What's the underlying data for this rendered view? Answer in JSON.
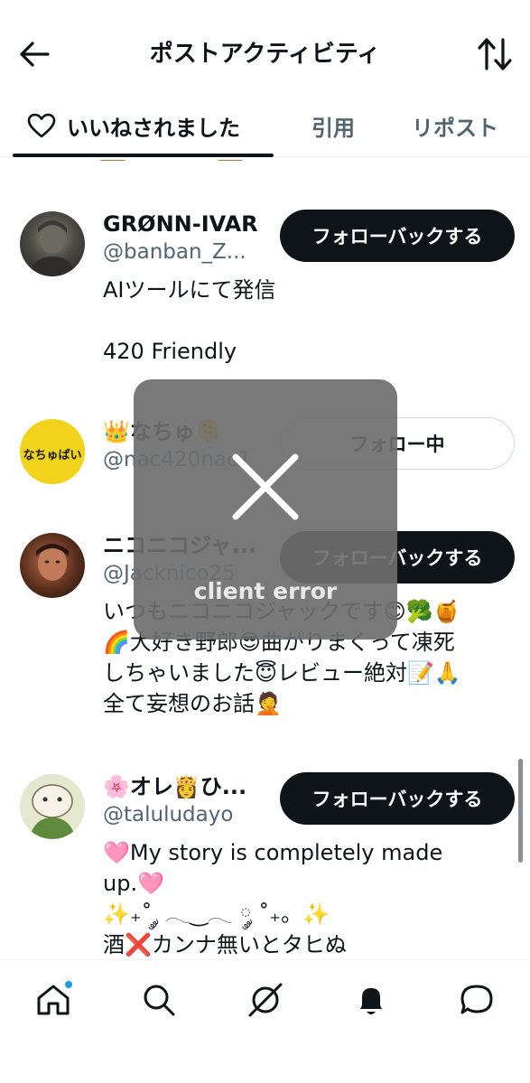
{
  "header": {
    "title": "ポストアクティビティ",
    "back_icon": "arrow-left-icon",
    "sort_icon": "sort-arrows-icon"
  },
  "tabs": [
    {
      "label": "いいねされました",
      "icon": "heart-icon",
      "active": true
    },
    {
      "label": "引用",
      "active": false
    },
    {
      "label": "リポスト",
      "active": false
    }
  ],
  "users": [
    {
      "name": "GRØNN-IVAR",
      "handle": "@banban_Z...",
      "button": "フォローバックする",
      "button_style": "dark",
      "bio_lines": [
        "AIツールにて発信",
        "",
        "420 Friendly"
      ]
    },
    {
      "name": "👑なちゅ🫠",
      "handle": "@nac420nac1",
      "button": "フォロー中",
      "button_style": "light",
      "avatar_text": "なちゅぱい",
      "bio_lines": []
    },
    {
      "name": "ニコニコジャ...",
      "handle": "@Jacknico25",
      "button": "フォローバックする",
      "button_style": "dark",
      "bio_lines": [
        "いつもニコニコジャックです😊🥦🍯",
        "🌈大好き野郎😎曲がりまくって凍死",
        "しちゃいました😇レビュー絶対📝🙏",
        "全て妄想のお話🤦"
      ]
    },
    {
      "name": "🌸オレ👸ひ...",
      "handle": "@taluludayo",
      "button": "フォローバックする",
      "button_style": "dark",
      "bio_lines": [
        "🩷My story is completely made",
        "up.🩷",
        "✨₊˚ ༘ 𓂃‿𓂃 ༘ ˚₊。✨",
        "酒❌カンナ無いとタヒぬ"
      ]
    }
  ],
  "error": {
    "text": "client error",
    "icon": "close-x-icon"
  },
  "bottom_nav": [
    {
      "name": "home",
      "icon": "home-icon",
      "has_dot": true
    },
    {
      "name": "search",
      "icon": "search-icon"
    },
    {
      "name": "grok",
      "icon": "grok-icon"
    },
    {
      "name": "notifications",
      "icon": "bell-icon"
    },
    {
      "name": "messages",
      "icon": "chat-bubble-icon"
    }
  ],
  "colors": {
    "primary_text": "#0f1419",
    "secondary_text": "#536471",
    "accent": "#1d9bf0",
    "dark_button": "#0f1419"
  }
}
